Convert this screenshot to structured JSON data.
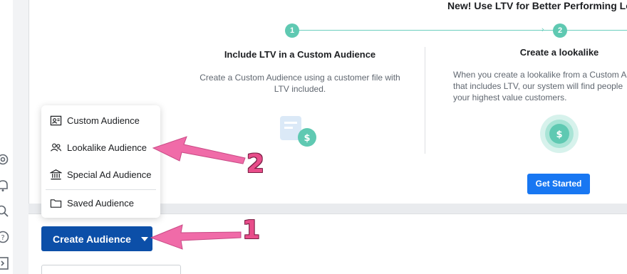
{
  "promo": {
    "title": "New! Use LTV for Better Performing Lo",
    "steps": [
      {
        "number": "1",
        "title": "Include LTV in a Custom Audience",
        "description": "Create a Custom Audience using a customer file with LTV included."
      },
      {
        "number": "2",
        "title": "Create a lookalike",
        "description": "When you create a lookalike from a Custom A that includes LTV, our system will find people your highest value customers."
      }
    ],
    "get_started_label": "Get Started",
    "dollar_glyph": "$"
  },
  "menu": {
    "items": [
      {
        "label": "Custom Audience",
        "icon": "audience-card-icon"
      },
      {
        "label": "Lookalike Audience",
        "icon": "people-icon"
      },
      {
        "label": "Special Ad Audience",
        "icon": "bank-building-icon"
      },
      {
        "label": "Saved Audience",
        "icon": "folder-icon"
      }
    ]
  },
  "create_button": {
    "label": "Create Audience",
    "icon": "caret-down-icon"
  },
  "annotations": [
    {
      "number": "1",
      "color": "#f06ba8"
    },
    {
      "number": "2",
      "color": "#f06ba8"
    }
  ],
  "leftnav": {
    "icons": [
      "gear-icon",
      "bell-icon",
      "search-icon",
      "help-icon",
      "sidebar-toggle-icon"
    ]
  },
  "colors": {
    "accent_teal": "#5fc9b2",
    "primary_blue": "#1877f2",
    "create_blue": "#0c4fa8",
    "annotation_pink": "#f06ba8"
  }
}
